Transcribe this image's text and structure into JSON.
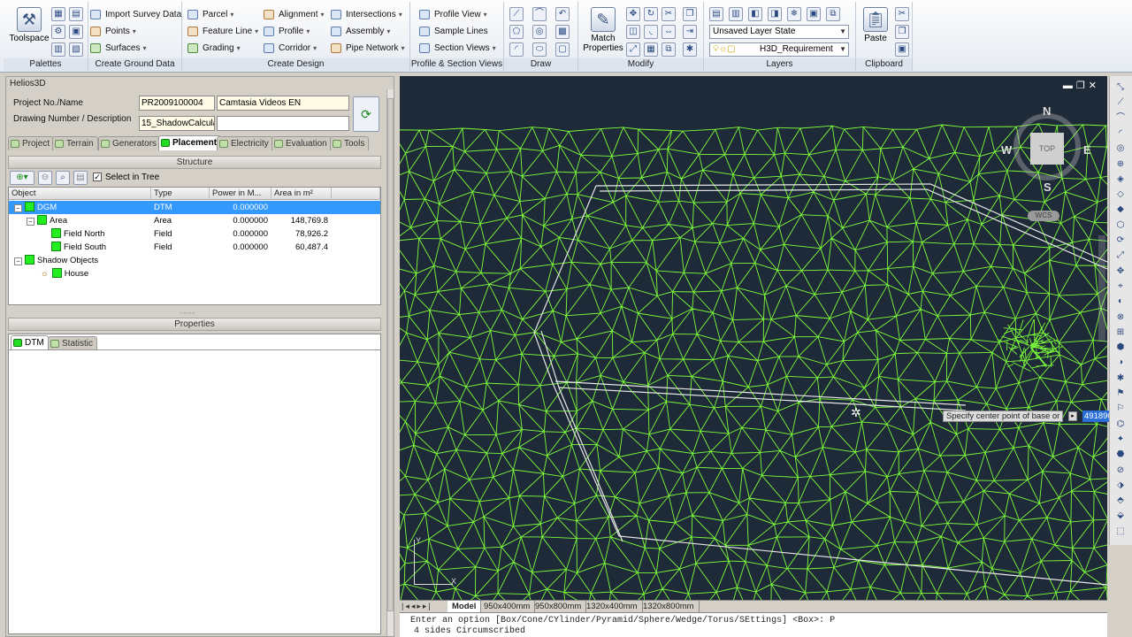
{
  "ribbon": {
    "palettes": {
      "toolspace": "Toolspace",
      "title": "Palettes"
    },
    "ground": {
      "items": [
        "Import Survey Data",
        "Points",
        "Surfaces"
      ],
      "title": "Create Ground Data"
    },
    "design": {
      "col1": [
        "Parcel",
        "Feature Line",
        "Grading"
      ],
      "col2": [
        "Alignment",
        "Profile",
        "Corridor"
      ],
      "col3": [
        "Intersections",
        "Assembly",
        "Pipe Network"
      ],
      "title": "Create Design"
    },
    "views": {
      "items": [
        "Profile View",
        "Sample Lines",
        "Section Views"
      ],
      "title": "Profile & Section Views"
    },
    "draw": {
      "title": "Draw"
    },
    "modify": {
      "match": "Match Properties",
      "title": "Modify"
    },
    "layers": {
      "state": "Unsaved Layer State",
      "layer": "H3D_Requirement",
      "title": "Layers"
    },
    "clipboard": {
      "paste": "Paste",
      "title": "Clipboard"
    }
  },
  "palette": {
    "title": "Helios3D",
    "project_label": "Project No./Name",
    "project_no": "PR2009100004",
    "project_name": "Camtasia Videos EN",
    "drawing_label": "Drawing Number / Description",
    "drawing_no": "15_ShadowCalcula",
    "drawing_desc": "",
    "tabs": [
      "Project",
      "Terrain",
      "Generators",
      "Placement",
      "Electricity",
      "Evaluation",
      "Tools"
    ],
    "structure_title": "Structure",
    "select_in_tree": "Select in Tree",
    "columns": [
      "Object",
      "Type",
      "Power in M...",
      "Area in m²"
    ],
    "rows": [
      {
        "name": "DGM",
        "type": "DTM",
        "power": "0.000000",
        "area": ""
      },
      {
        "name": "Area",
        "type": "Area",
        "power": "0.000000",
        "area": "148,769.8"
      },
      {
        "name": "Field North",
        "type": "Field",
        "power": "0.000000",
        "area": "78,926.2"
      },
      {
        "name": "Field South",
        "type": "Field",
        "power": "0.000000",
        "area": "60,487.4"
      },
      {
        "name": "Shadow Objects",
        "type": "",
        "power": "",
        "area": ""
      },
      {
        "name": "House",
        "type": "",
        "power": "",
        "area": ""
      }
    ],
    "properties_title": "Properties",
    "prop_tabs": [
      "DTM",
      "Statistic"
    ]
  },
  "viewport": {
    "cube": {
      "n": "N",
      "s": "S",
      "e": "E",
      "w": "W",
      "top": "TOP",
      "wcs": "WCS"
    },
    "tooltip": "Specify center point of base or",
    "coord": "491890.346",
    "model_tabs": [
      "Model",
      "950x400mm",
      "950x800mm",
      "1320x400mm",
      "1320x800mm"
    ]
  },
  "command": {
    "line1": "Enter an option [Box/Cone/CYlinder/Pyramid/Sphere/Wedge/Torus/SEttings] <Box>: P",
    "line2": "4 sides  Circumscribed"
  },
  "colors": {
    "mesh": "#7CFC3A",
    "viewport_bg": "#1f2a38",
    "selection": "#3399ff"
  }
}
